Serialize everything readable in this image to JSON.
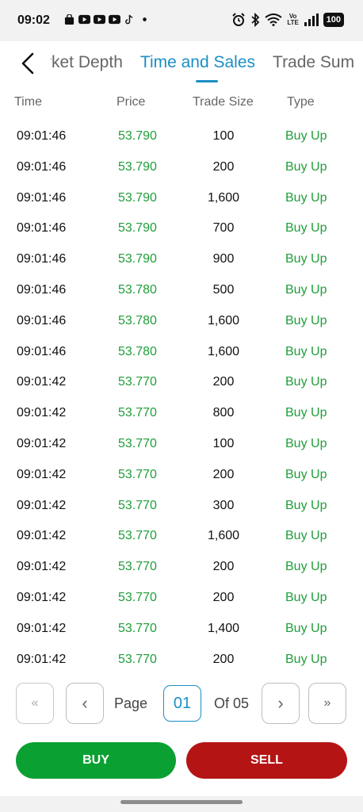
{
  "status_bar": {
    "time": "09:02",
    "notification_icons": [
      "shopping-bag-icon",
      "youtube-icon",
      "youtube-icon",
      "youtube-icon",
      "tiktok-icon",
      "dot-icon"
    ],
    "right_icons": [
      "alarm-icon",
      "bluetooth-icon",
      "wifi-icon",
      "volte-icon",
      "signal-icon"
    ],
    "volte_label": "Vo LTE",
    "battery": "100"
  },
  "tabs": [
    {
      "label": "rket Depth",
      "active": false
    },
    {
      "label": "Time and Sales",
      "active": true
    },
    {
      "label": "Trade Sum",
      "active": false
    }
  ],
  "table": {
    "headers": {
      "time": "Time",
      "price": "Price",
      "size": "Trade Size",
      "type": "Type"
    },
    "rows": [
      {
        "time": "09:01:46",
        "price": "53.790",
        "size": "100",
        "type": "Buy Up"
      },
      {
        "time": "09:01:46",
        "price": "53.790",
        "size": "200",
        "type": "Buy Up"
      },
      {
        "time": "09:01:46",
        "price": "53.790",
        "size": "1,600",
        "type": "Buy Up"
      },
      {
        "time": "09:01:46",
        "price": "53.790",
        "size": "700",
        "type": "Buy Up"
      },
      {
        "time": "09:01:46",
        "price": "53.790",
        "size": "900",
        "type": "Buy Up"
      },
      {
        "time": "09:01:46",
        "price": "53.780",
        "size": "500",
        "type": "Buy Up"
      },
      {
        "time": "09:01:46",
        "price": "53.780",
        "size": "1,600",
        "type": "Buy Up"
      },
      {
        "time": "09:01:46",
        "price": "53.780",
        "size": "1,600",
        "type": "Buy Up"
      },
      {
        "time": "09:01:42",
        "price": "53.770",
        "size": "200",
        "type": "Buy Up"
      },
      {
        "time": "09:01:42",
        "price": "53.770",
        "size": "800",
        "type": "Buy Up"
      },
      {
        "time": "09:01:42",
        "price": "53.770",
        "size": "100",
        "type": "Buy Up"
      },
      {
        "time": "09:01:42",
        "price": "53.770",
        "size": "200",
        "type": "Buy Up"
      },
      {
        "time": "09:01:42",
        "price": "53.770",
        "size": "300",
        "type": "Buy Up"
      },
      {
        "time": "09:01:42",
        "price": "53.770",
        "size": "1,600",
        "type": "Buy Up"
      },
      {
        "time": "09:01:42",
        "price": "53.770",
        "size": "200",
        "type": "Buy Up"
      },
      {
        "time": "09:01:42",
        "price": "53.770",
        "size": "200",
        "type": "Buy Up"
      },
      {
        "time": "09:01:42",
        "price": "53.770",
        "size": "1,400",
        "type": "Buy Up"
      },
      {
        "time": "09:01:42",
        "price": "53.770",
        "size": "200",
        "type": "Buy Up"
      }
    ]
  },
  "pagination": {
    "first": "«",
    "prev": "‹",
    "page_label": "Page",
    "current": "01",
    "of_label": "Of 05",
    "next": "›",
    "last": "»"
  },
  "actions": {
    "buy": "BUY",
    "sell": "SELL"
  },
  "colors": {
    "accent": "#1a8fc4",
    "price_up": "#1f9e3a",
    "buy": "#0aa032",
    "sell": "#b51414"
  }
}
